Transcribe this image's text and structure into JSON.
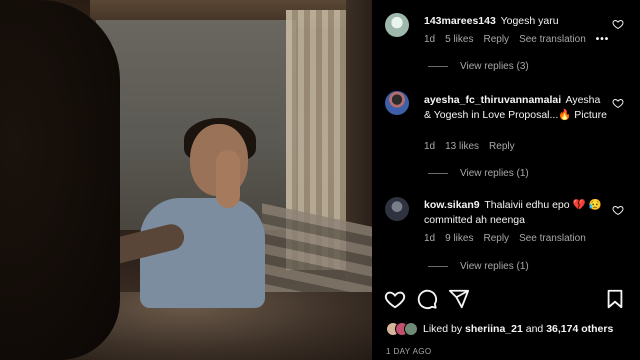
{
  "comments": [
    {
      "username": "143marees143",
      "text": "Yogesh yaru",
      "time": "1d",
      "likes": "5 likes",
      "reply_label": "Reply",
      "translate_label": "See translation",
      "more": "•••",
      "view_replies": "View replies (3)"
    },
    {
      "username": "ayesha_fc_thiruvannamalai",
      "text": "Ayesha & Yogesh in Love Proposal...🔥 Picture",
      "time": "1d",
      "likes": "13 likes",
      "reply_label": "Reply",
      "view_replies": "View replies (1)"
    },
    {
      "username": "kow.sikan9",
      "text": "Thalaivii edhu epo 💔 😥 committed ah neenga",
      "time": "1d",
      "likes": "9 likes",
      "reply_label": "Reply",
      "translate_label": "See translation",
      "view_replies": "View replies (1)"
    }
  ],
  "likes_summary": {
    "prefix": "Liked by",
    "user": "sheriina_21",
    "conjunction": "and",
    "count": "36,174 others"
  },
  "time_ago": "1 DAY AGO",
  "icons": {
    "like": "heart-icon",
    "comment": "comment-icon",
    "share": "share-icon",
    "save": "bookmark-icon"
  }
}
